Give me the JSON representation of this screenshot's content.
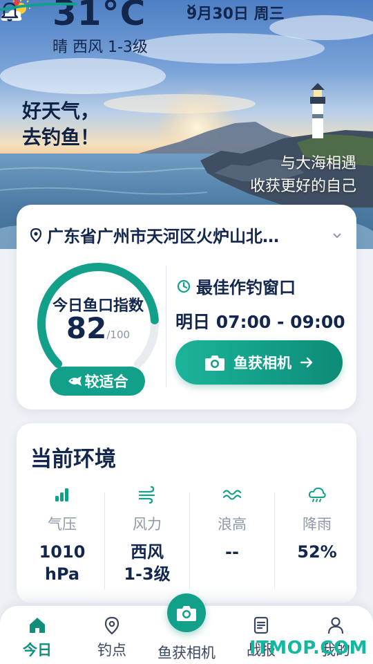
{
  "status": {
    "temperature": "31°C",
    "condition": "晴 西风 1-3级",
    "date": "9月30日 周三",
    "weather_icon": "sun-cloud-icon",
    "has_notification": true
  },
  "hero": {
    "slogan_line1": "好天气，",
    "slogan_line2": "去钓鱼！",
    "tagline_line1": "与大海相遇",
    "tagline_line2": "收获更好的自己"
  },
  "location": {
    "text": "广东省广州市天河区火炉山北…"
  },
  "fishing_index": {
    "title": "今日鱼口指数",
    "value": "82",
    "max_label": "/100",
    "score": 82,
    "max": 100,
    "rating": "较适合"
  },
  "best_window": {
    "title": "最佳作钓窗口",
    "time": "明日 07:00 - 09:00",
    "button_label": "鱼获相机"
  },
  "environment": {
    "title": "当前环境",
    "items": [
      {
        "icon": "signal-bars-icon",
        "label": "气压",
        "value_line1": "1010",
        "value_line2": "hPa"
      },
      {
        "icon": "wind-icon",
        "label": "风力",
        "value_line1": "西风",
        "value_line2": "1-3级"
      },
      {
        "icon": "wave-icon",
        "label": "浪高",
        "value_line1": "--",
        "value_line2": ""
      },
      {
        "icon": "rain-cloud-icon",
        "label": "降雨",
        "value_line1": "52%",
        "value_line2": ""
      }
    ]
  },
  "nav": {
    "home": "今日",
    "spots": "钓点",
    "camera": "鱼获相机",
    "reports": "战报",
    "me": "我的"
  },
  "watermark": "ITMOP.COM",
  "colors": {
    "accent": "#13a08a",
    "text_dark": "#13264d",
    "muted": "#8e98a8"
  }
}
